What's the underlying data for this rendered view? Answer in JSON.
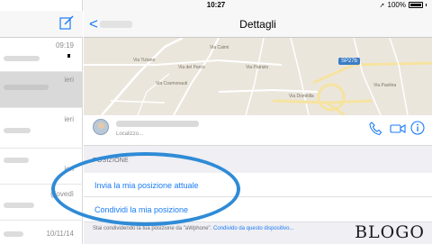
{
  "status_bar": {
    "time": "10:27",
    "battery": "100%"
  },
  "sidebar": {
    "rows": [
      {
        "date": "09:19"
      },
      {
        "date": "ieri"
      },
      {
        "date": "ieri"
      },
      {
        "date": "ieri"
      },
      {
        "date": "giovedì"
      },
      {
        "date": "10/11/14"
      }
    ]
  },
  "nav": {
    "back": "<",
    "title": "Dettagli"
  },
  "map": {
    "labels": [
      "Via Caimi",
      "Via Tiziano",
      "Via Cosmonauti",
      "Via del Parco",
      "Via Patrizio",
      "Via Domitilla",
      "Via Paolina"
    ],
    "road_badge": "SP27b"
  },
  "contact": {
    "subtitle": "Localizzo..."
  },
  "section": {
    "header": "POSIZIONE"
  },
  "options": {
    "send_current": "Invia la mia posizione attuale",
    "share": "Condividi la mia posizione"
  },
  "footer": {
    "text": "Stai condividendo la tua posizione da \"aWphone\".",
    "link": "Condivido da questo dispositivo..."
  },
  "watermark": "BLOGO",
  "colors": {
    "accent": "#1a7cf5",
    "annotation": "#2f8bd6"
  }
}
